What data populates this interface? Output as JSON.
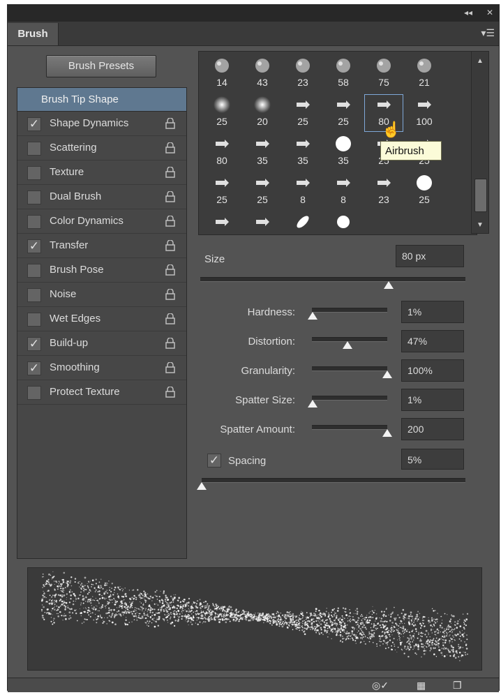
{
  "tab": {
    "title": "Brush"
  },
  "buttons": {
    "presets": "Brush Presets"
  },
  "left_list": {
    "header": "Brush Tip Shape",
    "items": [
      {
        "label": "Shape Dynamics",
        "checked": true
      },
      {
        "label": "Scattering",
        "checked": false
      },
      {
        "label": "Texture",
        "checked": false
      },
      {
        "label": "Dual Brush",
        "checked": false
      },
      {
        "label": "Color Dynamics",
        "checked": false
      },
      {
        "label": "Transfer",
        "checked": true
      },
      {
        "label": "Brush Pose",
        "checked": false
      },
      {
        "label": "Noise",
        "checked": false
      },
      {
        "label": "Wet Edges",
        "checked": false
      },
      {
        "label": "Build-up",
        "checked": true
      },
      {
        "label": "Smoothing",
        "checked": true
      },
      {
        "label": "Protect Texture",
        "checked": false
      }
    ]
  },
  "brush_tips": {
    "rows": [
      [
        "14",
        "43",
        "23",
        "58",
        "75",
        "21"
      ],
      [
        "25",
        "20",
        "25",
        "25",
        "80",
        "100"
      ],
      [
        "80",
        "35",
        "35",
        "35",
        "25",
        "25"
      ],
      [
        "25",
        "25",
        "8",
        "8",
        "23",
        "25"
      ],
      [
        "",
        "",
        "",
        ""
      ]
    ],
    "tooltip": "Airbrush"
  },
  "settings": {
    "size_label": "Size",
    "size_value": "80 px",
    "size_level": 0.71,
    "params": [
      {
        "label": "Hardness:",
        "value": "1%",
        "level": 0.01
      },
      {
        "label": "Distortion:",
        "value": "47%",
        "level": 0.47
      },
      {
        "label": "Granularity:",
        "value": "100%",
        "level": 1.0
      },
      {
        "label": "Spatter Size:",
        "value": "1%",
        "level": 0.01
      },
      {
        "label": "Spatter Amount:",
        "value": "200",
        "level": 1.0
      }
    ],
    "spacing_label": "Spacing",
    "spacing_checked": true,
    "spacing_value": "5%",
    "spacing_level": 0.0
  }
}
